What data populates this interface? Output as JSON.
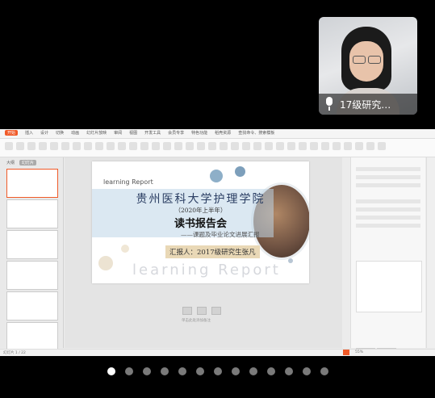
{
  "video": {
    "participant_name": "17级研究…",
    "mic_icon": "microphone-icon"
  },
  "menu": {
    "items": [
      "开始",
      "插入",
      "设计",
      "切换",
      "动画",
      "幻灯片放映",
      "审阅",
      "视图",
      "开发工具",
      "会员专享",
      "特色功能",
      "稻壳资源",
      "查找命令、搜索模板"
    ],
    "active_index": 0
  },
  "sidebar": {
    "tabs": [
      "大纲",
      "幻灯片"
    ],
    "active_tab": 1,
    "thumbnail_count": 6
  },
  "slide": {
    "small_title": "learning Report",
    "university": "贵州医科大学护理学院",
    "year": "（2020年上半年）",
    "headline": "读书报告会",
    "subtitle": "——课题及毕业论文进展汇报",
    "presenter": "汇报人：2017级研究生张凡",
    "big_watermark": "learning Report"
  },
  "notes_placeholder": "单击此处添加备注",
  "status": {
    "left": "幻灯片 1 / 22",
    "zoom": "55%"
  },
  "carousel": {
    "dot_count": 13,
    "active_index": 0
  },
  "colors": {
    "accent": "#f05a28",
    "slide_blue": "#2b3e63"
  }
}
